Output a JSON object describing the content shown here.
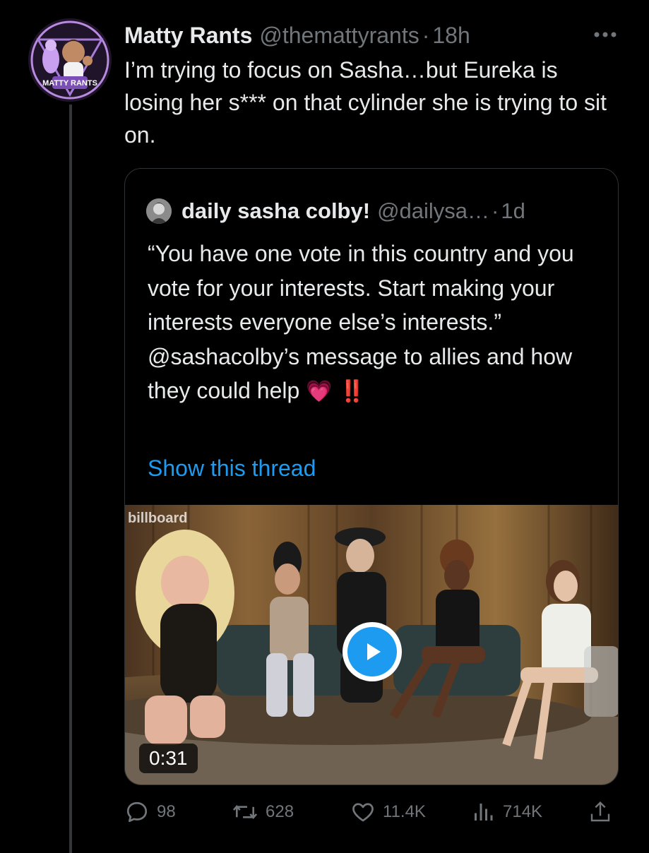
{
  "tweet": {
    "display_name": "Matty Rants",
    "handle": "@themattyrants",
    "separator": "·",
    "time": "18h",
    "text": "I’m trying to focus on Sasha…but Eureka is losing her s*** on that cylinder she is trying to sit on.",
    "avatar_badge_text": "MATTY RANTS",
    "more_icon": "more-horizontal-icon"
  },
  "quote": {
    "display_name": "daily sasha colby!",
    "handle": "@dailysa…",
    "separator": "·",
    "time": "1d",
    "text": "“You have one vote in this country and you vote for your interests. Start making your interests everyone else’s interests.” @sashacolby’s message to allies and how they could help",
    "emojis": "💗 ‼️",
    "show_thread": "Show this thread",
    "video": {
      "watermark": "billboard",
      "duration": "0:31",
      "play_icon": "play-icon"
    }
  },
  "actions": {
    "replies": "98",
    "retweets": "628",
    "likes": "11.4K",
    "views": "714K",
    "reply_icon": "reply-icon",
    "retweet_icon": "retweet-icon",
    "like_icon": "heart-icon",
    "views_icon": "views-icon",
    "share_icon": "share-icon"
  },
  "colors": {
    "background": "#000000",
    "text": "#e7e9ea",
    "muted": "#71767b",
    "link": "#1d9bf0",
    "border": "#2f3336"
  }
}
